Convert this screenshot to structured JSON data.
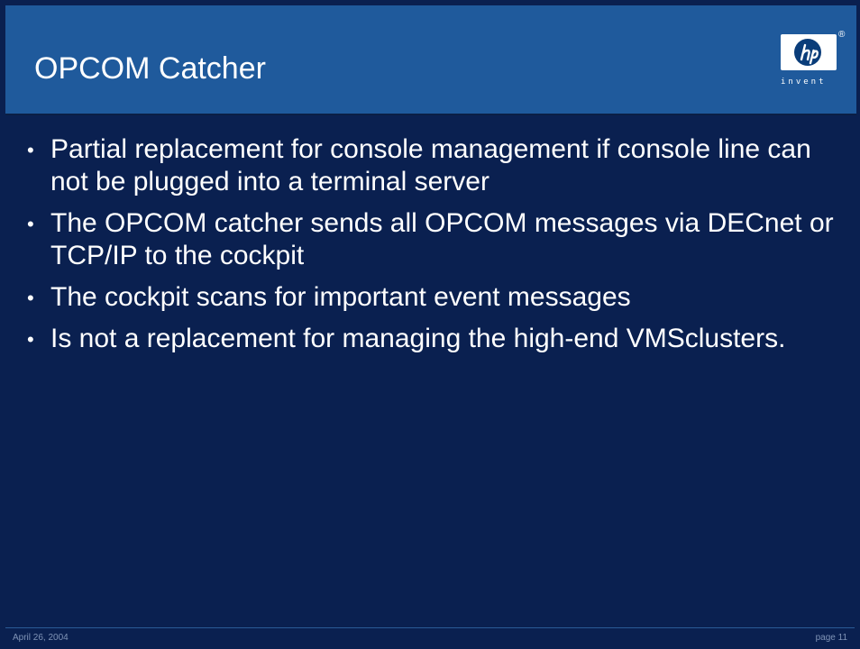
{
  "slide": {
    "title": "OPCOM Catcher",
    "logo": {
      "icon": "hp-logo-icon",
      "registered": "®",
      "tagline": "invent"
    },
    "bullets": [
      {
        "text": "Partial replacement for console management if console line can not be plugged into a terminal server"
      },
      {
        "text": "The OPCOM catcher sends all OPCOM messages via DECnet or TCP/IP to the cockpit"
      },
      {
        "text": "The cockpit scans for important event messages"
      },
      {
        "text": "Is not a replacement for managing the high-end VMSclusters."
      }
    ]
  },
  "footer": {
    "date": "April 26, 2004",
    "page": "page 11"
  },
  "colors": {
    "background": "#0a2050",
    "header": "#1f5a9c",
    "text": "#ffffff",
    "footer_text": "#7f93b6"
  }
}
